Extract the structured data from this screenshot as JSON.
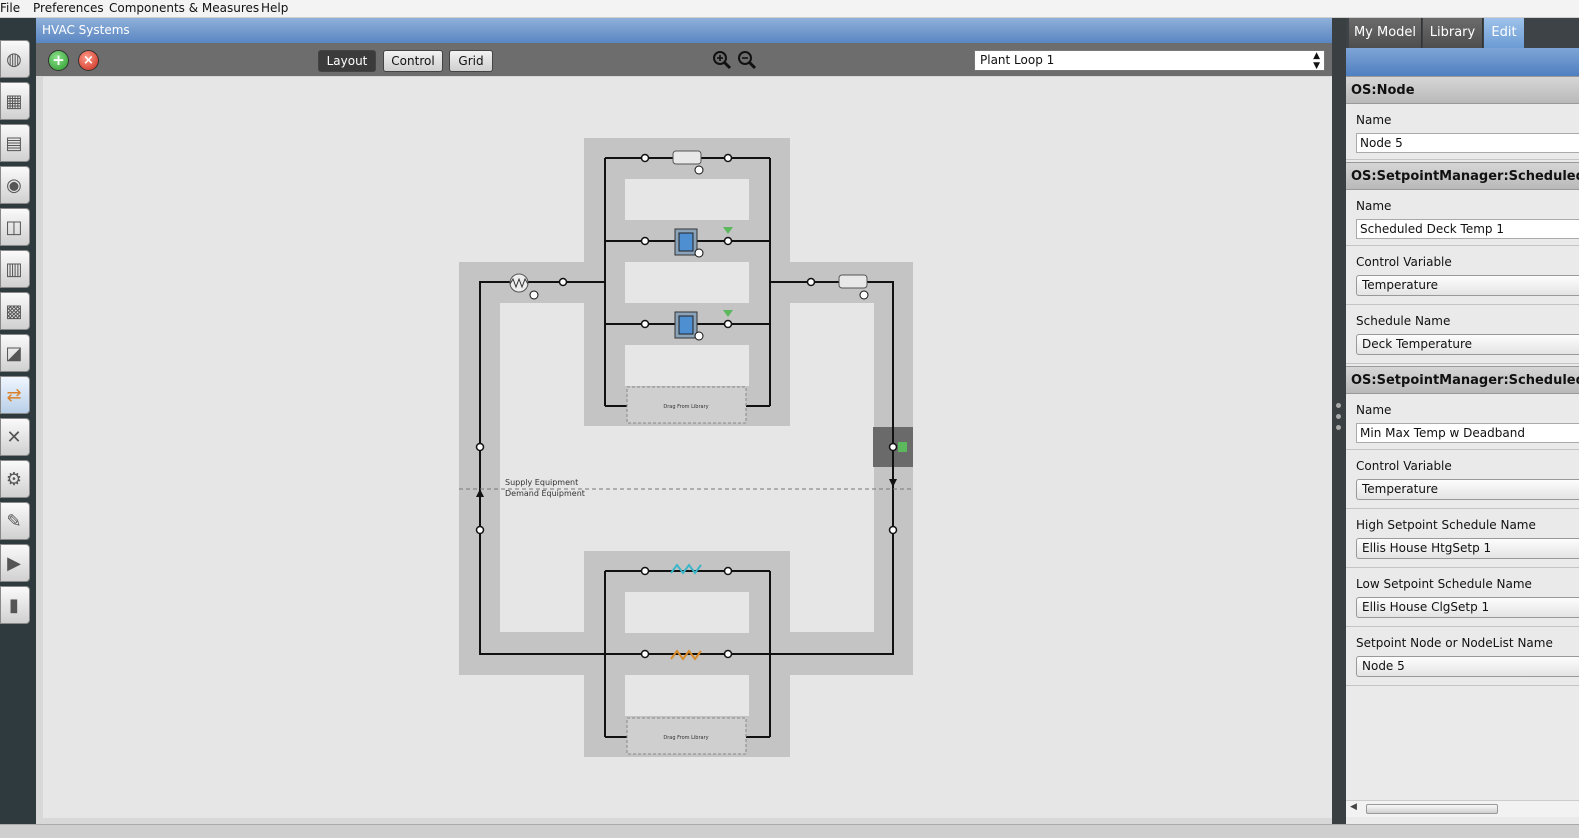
{
  "menu": [
    "File",
    "Preferences",
    "Components & Measures",
    "Help"
  ],
  "hvac": {
    "title": "HVAC Systems",
    "view_buttons": [
      "Layout",
      "Control",
      "Grid"
    ],
    "loop_select": "Plant Loop 1"
  },
  "canvas": {
    "supply_label": "Supply Equipment",
    "demand_label": "Demand Equipment",
    "drop_label": "Drag From Library"
  },
  "right_panel": {
    "tabs": [
      "My Model",
      "Library",
      "Edit"
    ],
    "active_tab": "Edit",
    "sections": [
      {
        "title": "OS:Node",
        "fields": [
          {
            "label": "Name",
            "kind": "input",
            "value": "Node 5"
          }
        ]
      },
      {
        "title": "OS:SetpointManager:Scheduled",
        "fields": [
          {
            "label": "Name",
            "kind": "input",
            "value": "Scheduled Deck Temp 1"
          },
          {
            "label": "Control Variable",
            "kind": "select",
            "value": "Temperature"
          },
          {
            "label": "Schedule Name",
            "kind": "select",
            "value": "Deck Temperature"
          }
        ]
      },
      {
        "title": "OS:SetpointManager:Scheduled:D",
        "fields": [
          {
            "label": "Name",
            "kind": "input",
            "value": "Min Max Temp w Deadband"
          },
          {
            "label": "Control Variable",
            "kind": "select",
            "value": "Temperature"
          },
          {
            "label": "High Setpoint Schedule Name",
            "kind": "select",
            "value": "Ellis House HtgSetp 1"
          },
          {
            "label": "Low Setpoint Schedule Name",
            "kind": "select",
            "value": "Ellis House ClgSetp 1"
          },
          {
            "label": "Setpoint Node or NodeList Name",
            "kind": "select",
            "value": "Node 5"
          }
        ]
      }
    ]
  },
  "left_toolbar_icons": [
    "site-icon",
    "schedules-icon",
    "constructions-icon",
    "loads-icon",
    "space-types-icon",
    "geometry-icon",
    "facility-icon",
    "spaces-icon",
    "hvac-systems-icon",
    "building-summary-icon",
    "simulation-settings-icon",
    "scripts-icon",
    "run-simulation-icon",
    "results-summary-icon"
  ],
  "colors": {
    "accent_blue": "#6b9bd4",
    "add_green": "#3aa63a",
    "remove_red": "#d23a2a",
    "panel_dark": "#2f3a3e"
  }
}
